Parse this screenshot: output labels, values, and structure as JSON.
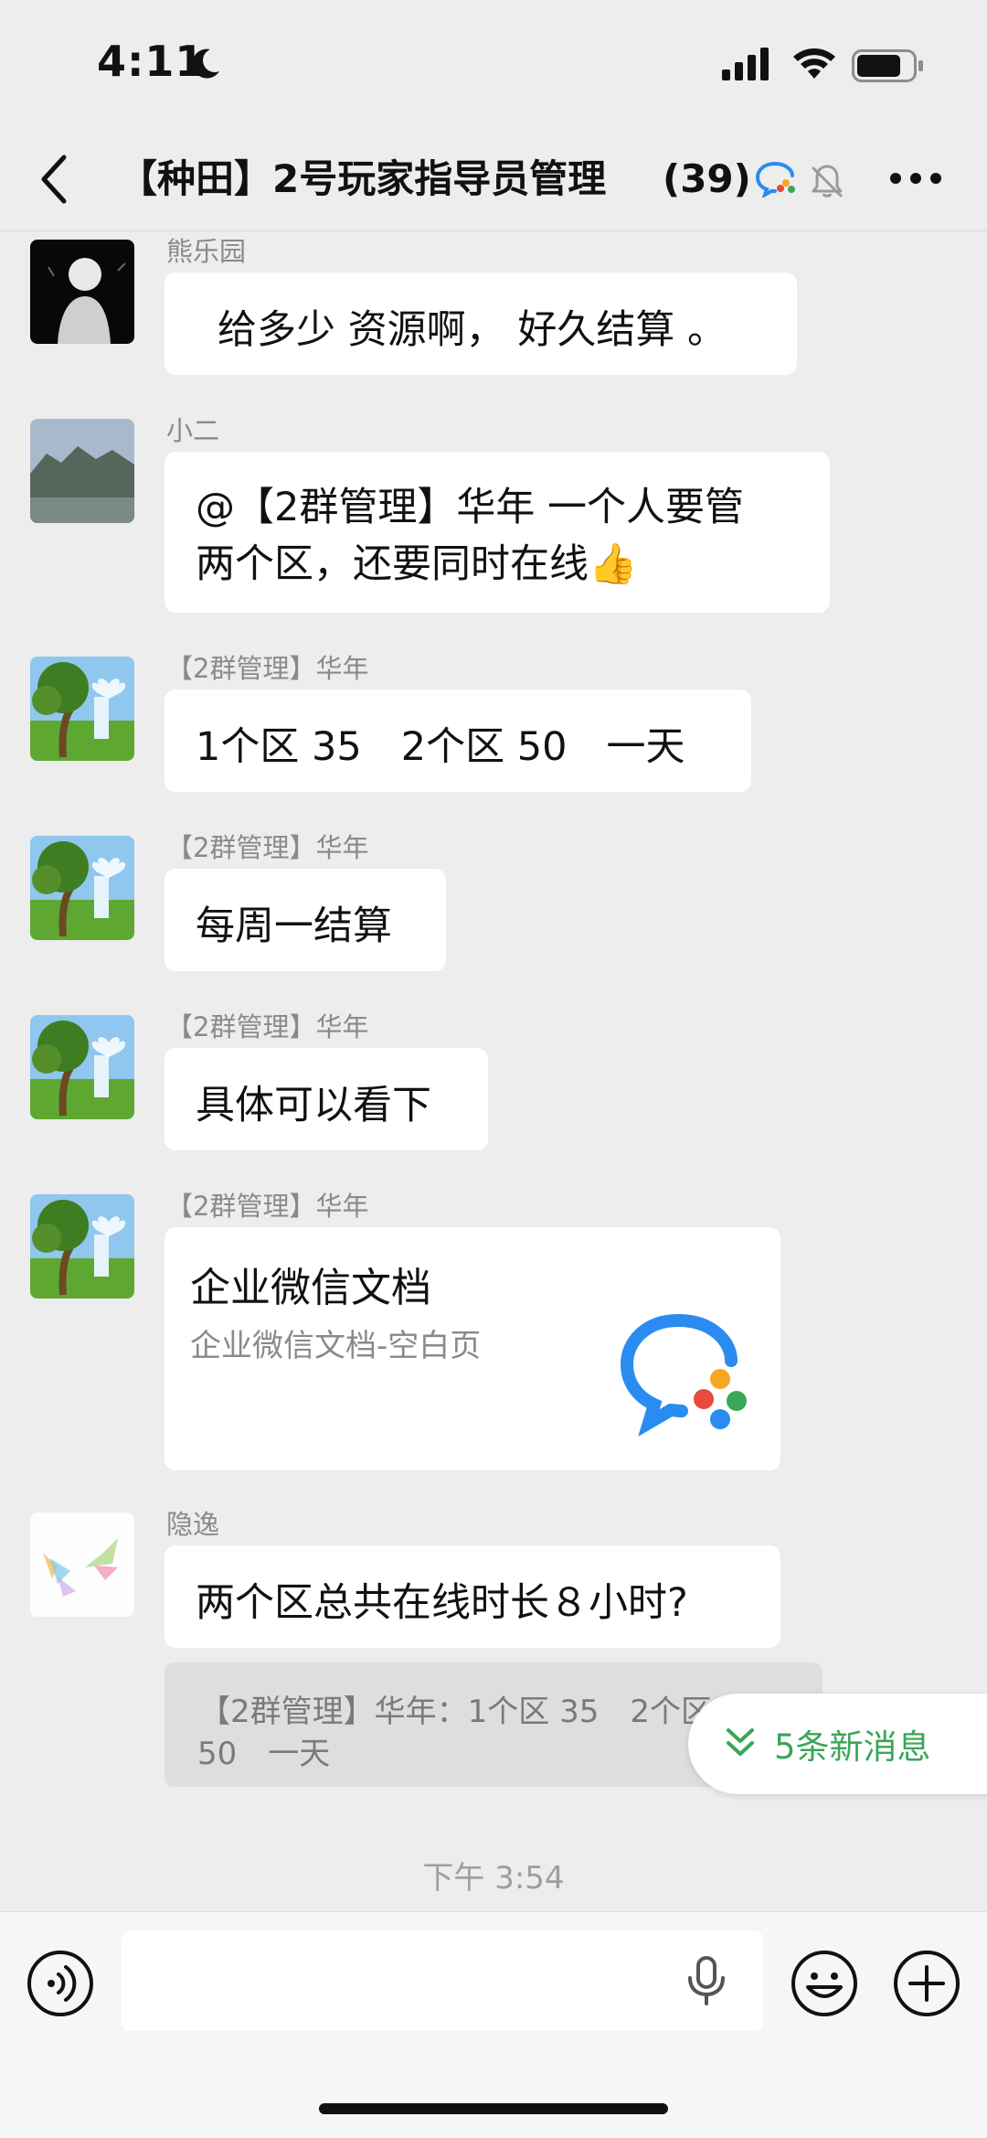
{
  "status_bar": {
    "time": "4:11",
    "battery_level": 0.8
  },
  "header": {
    "title": "【种田】2号玩家指导员管理",
    "member_count": "(39)"
  },
  "messages": [
    {
      "sender": "熊乐园",
      "avatar": "dark-figure-avatar",
      "text": "给多少 资源啊， 好久结算 。"
    },
    {
      "sender": "小二",
      "avatar": "mountain-avatar",
      "text_line1": "@【2群管理】华年 一个人要管",
      "text_line2": "两个区，还要同时在线👍"
    },
    {
      "sender": "【2群管理】华年",
      "avatar": "landscape-avatar",
      "text": "1个区 35　2个区 50　一天"
    },
    {
      "sender": "【2群管理】华年",
      "avatar": "landscape-avatar",
      "text": "每周一结算"
    },
    {
      "sender": "【2群管理】华年",
      "avatar": "landscape-avatar",
      "text": "具体可以看下"
    },
    {
      "sender": "【2群管理】华年",
      "avatar": "landscape-avatar",
      "card": {
        "title": "企业微信文档",
        "subtitle": "企业微信文档-空白页"
      }
    },
    {
      "sender": "隐逸",
      "avatar": "rainbow-birds-avatar",
      "text": "两个区总共在线时长８小时?",
      "quote_line1": "【2群管理】华年：1个区 35　2个区",
      "quote_line2": "50　一天"
    }
  ],
  "new_messages_label": "5条新消息",
  "timestamp": "下午 3:54",
  "colors": {
    "background": "#ededed",
    "bubble": "#ffffff",
    "accent_green": "#3aa657"
  }
}
